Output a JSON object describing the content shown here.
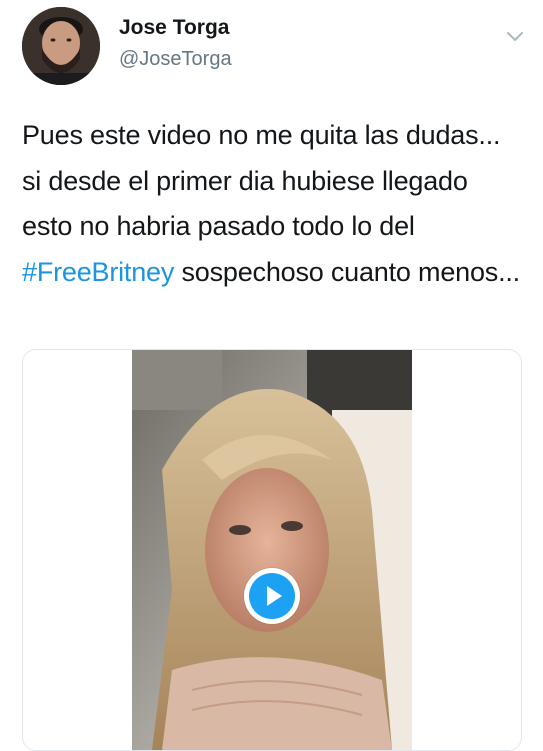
{
  "tweet": {
    "author": {
      "name": "Jose Torga",
      "handle": "@JoseTorga",
      "avatar_icon": "user-avatar"
    },
    "text_before": "Pues este video no me quita las dudas... si desde el primer dia hubiese llegado esto no habria pasado todo lo del ",
    "hashtag": "#FreeBritney",
    "text_after": " sospechoso cuanto menos...",
    "menu_icon": "chevron-down-icon",
    "media": {
      "type": "video",
      "play_icon": "play-icon"
    }
  },
  "colors": {
    "text": "#14171a",
    "secondary": "#657786",
    "link": "#1b95e0",
    "play_accent": "#1da1f2",
    "border": "#e1e8ed"
  }
}
